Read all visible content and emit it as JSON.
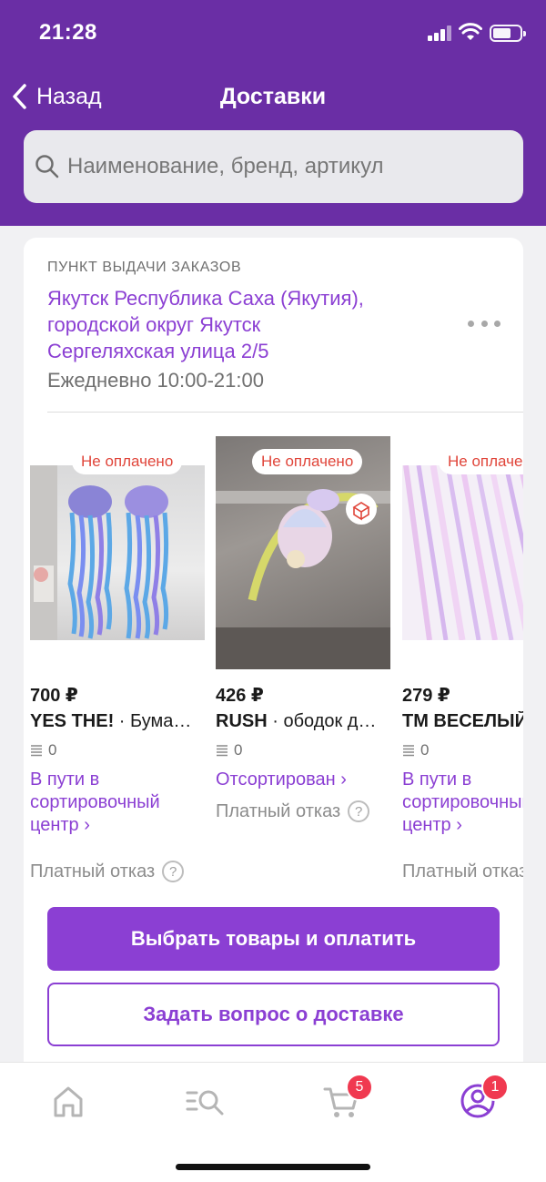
{
  "status_bar": {
    "time": "21:28"
  },
  "nav": {
    "back_label": "Назад",
    "title": "Доставки"
  },
  "search": {
    "placeholder": "Наименование, бренд, артикул"
  },
  "pickup": {
    "label": "ПУНКТ ВЫДАЧИ ЗАКАЗОВ",
    "address_line1": "Якутск Республика Саха (Якутия),",
    "address_line2": "городской округ Якутск",
    "address_line3": "Сергеляхская улица 2/5",
    "hours": "Ежедневно 10:00-21:00"
  },
  "products": [
    {
      "badge": "Не оплачено",
      "price": "700 ₽",
      "brand": "YES THE!",
      "name": " · Бумажные медузы",
      "reviews": "0",
      "status": "В пути в сортировочный центр ›",
      "refuse": "Платный отказ"
    },
    {
      "badge": "Не оплачено",
      "price": "426 ₽",
      "brand": "RUSH",
      "name": " · ободок для волос",
      "reviews": "0",
      "status": "Отсортирован ›",
      "refuse": "Платный отказ"
    },
    {
      "badge": "Не оплачено",
      "price": "279 ₽",
      "brand": "ТМ ВЕСЕЛЫЙ ПРАЗДНИК",
      "name": "",
      "reviews": "0",
      "status": "В пути в сортировочный центр ›",
      "refuse": "Платный отказ"
    }
  ],
  "buttons": {
    "pay": "Выбрать товары и оплатить",
    "ask": "Задать вопрос о доставке"
  },
  "tabbar": {
    "cart_badge": "5",
    "profile_badge": "1"
  },
  "colors": {
    "header": "#6a2ea5",
    "accent": "#8b3fd3",
    "badge_red": "#e0453a",
    "tab_badge": "#f03950"
  }
}
